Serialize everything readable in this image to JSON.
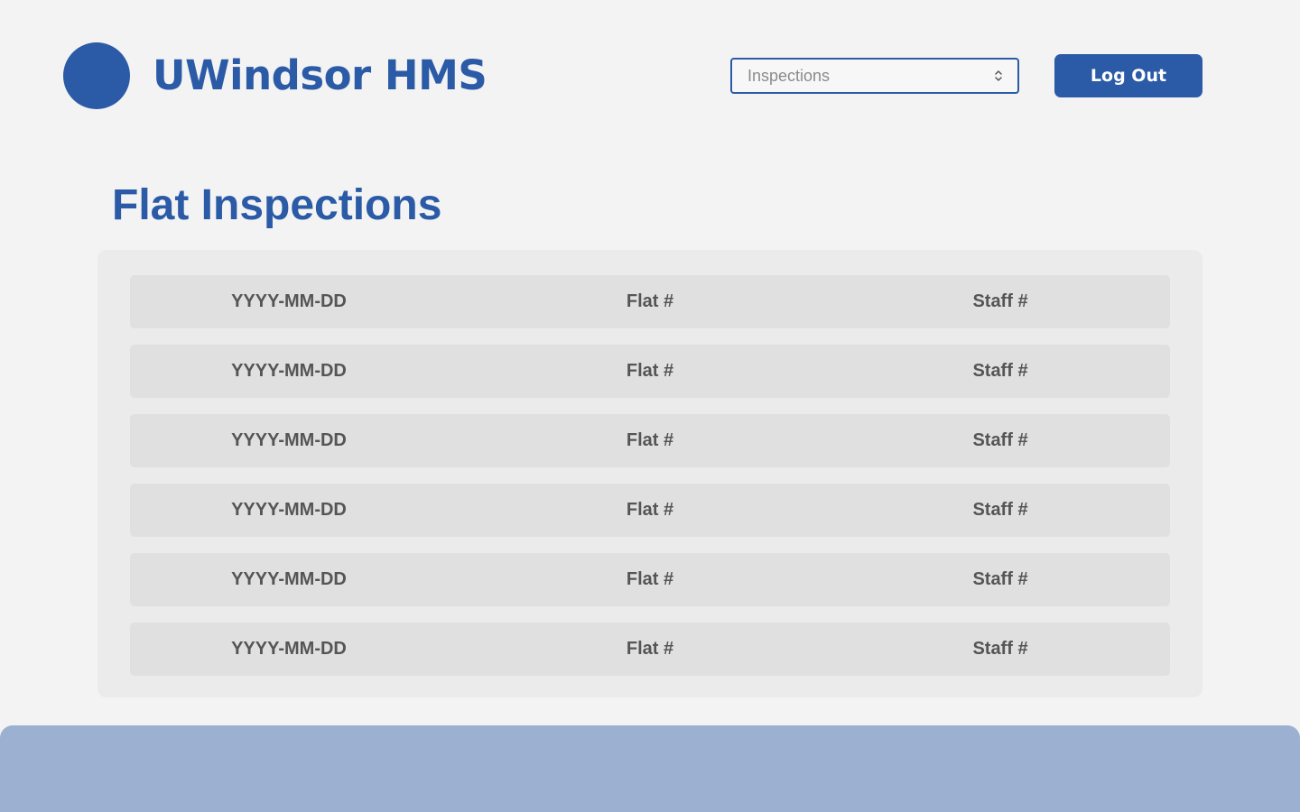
{
  "header": {
    "app_title": "UWindsor HMS",
    "nav_select": {
      "value": "Inspections"
    },
    "logout_label": "Log Out"
  },
  "main": {
    "page_title": "Flat Inspections",
    "rows": [
      {
        "date": "YYYY-MM-DD",
        "flat": "Flat #",
        "staff": "Staff #"
      },
      {
        "date": "YYYY-MM-DD",
        "flat": "Flat #",
        "staff": "Staff #"
      },
      {
        "date": "YYYY-MM-DD",
        "flat": "Flat #",
        "staff": "Staff #"
      },
      {
        "date": "YYYY-MM-DD",
        "flat": "Flat #",
        "staff": "Staff #"
      },
      {
        "date": "YYYY-MM-DD",
        "flat": "Flat #",
        "staff": "Staff #"
      },
      {
        "date": "YYYY-MM-DD",
        "flat": "Flat #",
        "staff": "Staff #"
      }
    ]
  },
  "icons": {
    "logo": "logo-circle-icon",
    "select_arrows": "chevron-up-down-icon"
  },
  "colors": {
    "brand": "#2b5ba6",
    "background": "#f3f3f4",
    "panel": "#ebebec",
    "row": "#e0e0e1",
    "footer": "#9cb0d1",
    "row_text": "#555555"
  }
}
